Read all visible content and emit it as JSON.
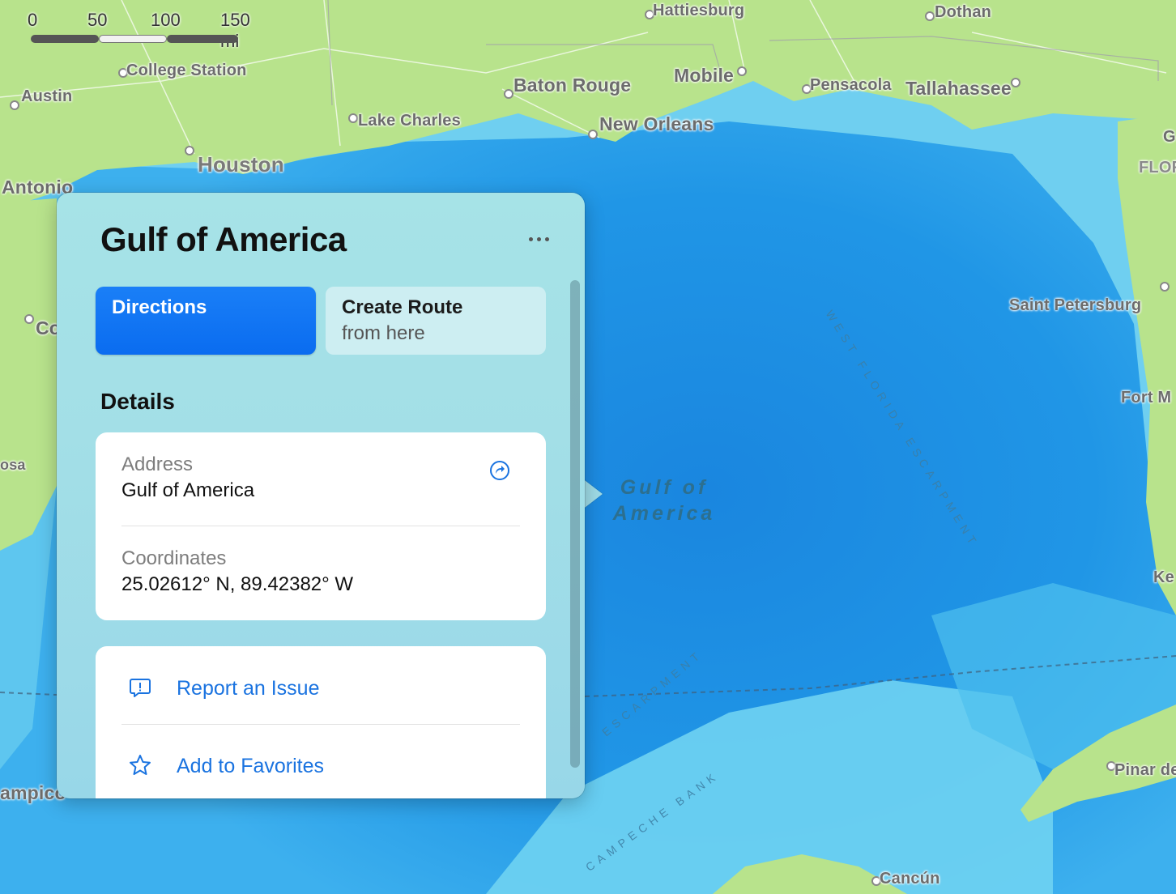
{
  "scale": {
    "labels": [
      "0",
      "50",
      "100",
      "150 mi"
    ]
  },
  "map": {
    "cities": [
      {
        "name": "Hattiesburg"
      },
      {
        "name": "Dothan"
      },
      {
        "name": "College Station"
      },
      {
        "name": "Austin"
      },
      {
        "name": "Baton Rouge"
      },
      {
        "name": "Mobile"
      },
      {
        "name": "Pensacola"
      },
      {
        "name": "Tallahassee"
      },
      {
        "name": "Lake Charles"
      },
      {
        "name": "New Orleans"
      },
      {
        "name": "Houston"
      },
      {
        "name": "Antonio"
      },
      {
        "name": "Co"
      },
      {
        "name": "osa"
      },
      {
        "name": "ampico"
      },
      {
        "name": "Saint Petersburg"
      },
      {
        "name": "Fort M"
      },
      {
        "name": "Ke"
      },
      {
        "name": "FLOR"
      },
      {
        "name": "G"
      },
      {
        "name": "Pinar de"
      },
      {
        "name": "Cancún"
      }
    ],
    "water_label": {
      "line1": "Gulf of",
      "line2": "America"
    },
    "features": {
      "west_florida": "WEST FLORIDA ESCARPMENT",
      "campeche_escarpment": "ESCARPMENT",
      "campeche_bank": "CAMPECHE BANK"
    }
  },
  "popover": {
    "title": "Gulf of America",
    "more_label": "More",
    "directions_label": "Directions",
    "create_route_line1": "Create Route",
    "create_route_line2": "from here",
    "details_title": "Details",
    "details": {
      "address_key": "Address",
      "address_value": "Gulf of America",
      "coordinates_key": "Coordinates",
      "coordinates_value": "25.02612° N, 89.42382° W"
    },
    "actions": {
      "report_label": "Report an Issue",
      "favorites_label": "Add to Favorites"
    }
  },
  "colors": {
    "land": "#b7e08a",
    "water_deep": "#1f8fe0",
    "water_shallow": "#8fe3f2",
    "accent": "#0a6cf0",
    "link": "#1a73e0"
  }
}
